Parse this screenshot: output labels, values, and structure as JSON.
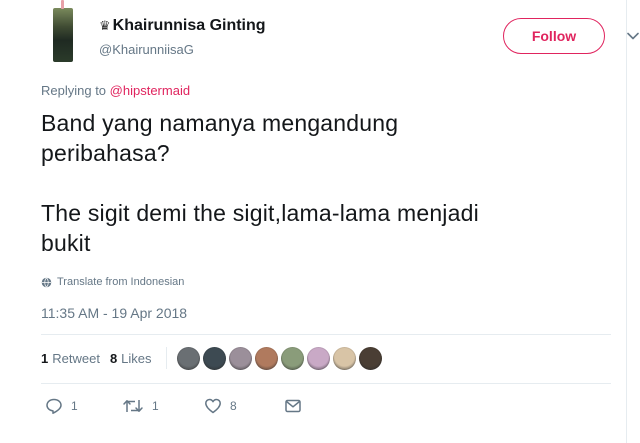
{
  "user": {
    "display_name": "♛Khairunnisa Ginting",
    "crown": "♛",
    "name_text": "Khairunnisa Ginting",
    "handle": "@KhairunniisaG"
  },
  "follow_label": "Follow",
  "reply": {
    "prefix": "Replying to",
    "mention": "@hipstermaid"
  },
  "tweet": {
    "line1": "Band yang namanya mengandung",
    "line2": "peribahasa?",
    "line3": "The sigit demi the sigit,lama-lama menjadi",
    "line4": "bukit"
  },
  "translate_label": "Translate from Indonesian",
  "timestamp": "11:35 AM - 19 Apr 2018",
  "stats": {
    "retweets_count": "1",
    "retweets_label": "Retweet",
    "likes_count": "8",
    "likes_label": "Likes"
  },
  "likers": [
    {
      "name": "liker-avatar-1",
      "color": "#6a6f73"
    },
    {
      "name": "liker-avatar-2",
      "color": "#3d4a52"
    },
    {
      "name": "liker-avatar-3",
      "color": "#9b8f9a"
    },
    {
      "name": "liker-avatar-4",
      "color": "#b07a5e"
    },
    {
      "name": "liker-avatar-5",
      "color": "#8a9c7a"
    },
    {
      "name": "liker-avatar-6",
      "color": "#c9a9c6"
    },
    {
      "name": "liker-avatar-7",
      "color": "#d8c4a6"
    },
    {
      "name": "liker-avatar-8",
      "color": "#4a3e34"
    }
  ],
  "actions": {
    "reply_count": "1",
    "retweet_count": "1",
    "like_count": "8"
  },
  "colors": {
    "accent": "#e0245e",
    "muted": "#657786",
    "text": "#14171a",
    "border": "#e6ecf0"
  },
  "icons": [
    "chevron-down-icon",
    "globe-icon",
    "reply-icon",
    "retweet-icon",
    "like-icon",
    "message-icon"
  ]
}
